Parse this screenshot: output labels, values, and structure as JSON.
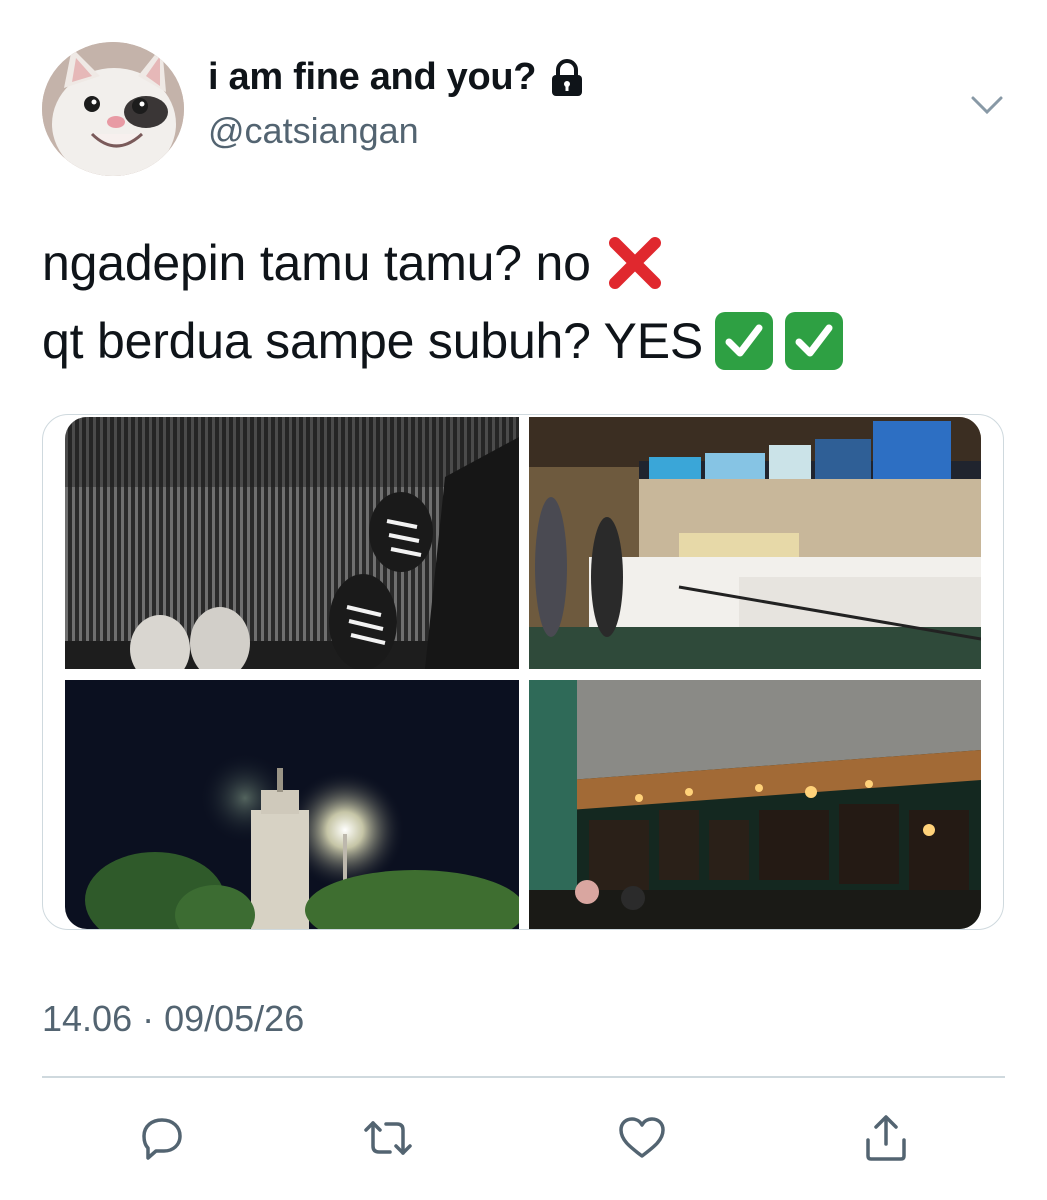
{
  "user": {
    "display_name": "i am fine and you?",
    "handle": "@catsiangan",
    "protected_icon": "lock-icon",
    "avatar": "cat-face-avatar"
  },
  "tweet": {
    "line1_text": "ngadepin tamu tamu? no",
    "line1_emoji": "cross-mark-emoji",
    "line2_text": "qt berdua sampe subuh? YES",
    "line2_emoji": "check-mark-button-emoji"
  },
  "media": [
    {
      "name": "escalator-shoes-photo"
    },
    {
      "name": "cinema-concession-photo"
    },
    {
      "name": "night-tower-lights-photo"
    },
    {
      "name": "outdoor-food-stalls-photo"
    }
  ],
  "meta": {
    "timestamp": "14.06 · 09/05/26"
  },
  "actions": [
    {
      "icon": "reply-icon"
    },
    {
      "icon": "retweet-icon"
    },
    {
      "icon": "like-icon"
    },
    {
      "icon": "share-icon"
    }
  ],
  "colors": {
    "text": "#0f1419",
    "secondary": "#536471",
    "border": "#cfd9de",
    "cross_red": "#e0282e",
    "check_green": "#2ea043"
  }
}
